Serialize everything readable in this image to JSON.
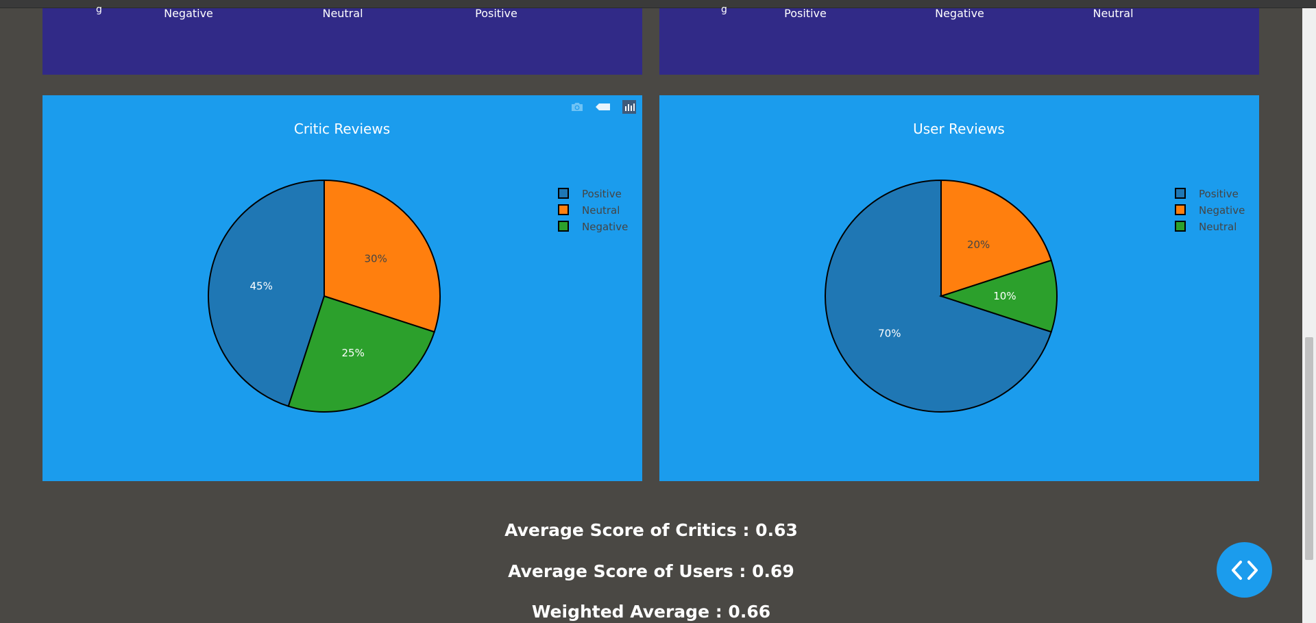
{
  "top_panels": {
    "left": {
      "labels": [
        "Negative",
        "Neutral",
        "Positive"
      ]
    },
    "right": {
      "labels": [
        "Positive",
        "Negative",
        "Neutral"
      ]
    }
  },
  "charts": [
    {
      "title": "Critic Reviews",
      "legend": [
        "Positive",
        "Neutral",
        "Negative"
      ]
    },
    {
      "title": "User Reviews",
      "legend": [
        "Positive",
        "Negative",
        "Neutral"
      ]
    }
  ],
  "chart_data": [
    {
      "type": "pie",
      "title": "Critic Reviews",
      "labels": [
        "Positive",
        "Neutral",
        "Negative"
      ],
      "values": [
        45,
        30,
        25
      ],
      "slice_order": [
        "Positive",
        "Negative",
        "Neutral"
      ],
      "text": [
        "45%",
        "30%",
        "25%"
      ],
      "colors": [
        "#1f77b4",
        "#ff7f0e",
        "#2ca02c"
      ],
      "legend_position": "top-right"
    },
    {
      "type": "pie",
      "title": "User Reviews",
      "labels": [
        "Positive",
        "Negative",
        "Neutral"
      ],
      "values": [
        70,
        20,
        10
      ],
      "slice_order": [
        "Positive",
        "Neutral",
        "Negative"
      ],
      "text": [
        "70%",
        "20%",
        "10%"
      ],
      "colors": [
        "#1f77b4",
        "#ff7f0e",
        "#2ca02c"
      ],
      "legend_position": "top-right"
    }
  ],
  "scores": {
    "critics": "Average Score of Critics : 0.63",
    "users": "Average Score of Users : 0.69",
    "weighted": "Weighted Average : 0.66"
  },
  "modebar_icons": [
    "camera-icon",
    "tag-icon",
    "plotly-logo-icon"
  ],
  "fab_icon": "code-icon",
  "colors": {
    "page_bg": "#4a4844",
    "top_panel_bg": "#312a87",
    "chart_bg": "#1b9ced",
    "fab_bg": "#1b9ced"
  }
}
